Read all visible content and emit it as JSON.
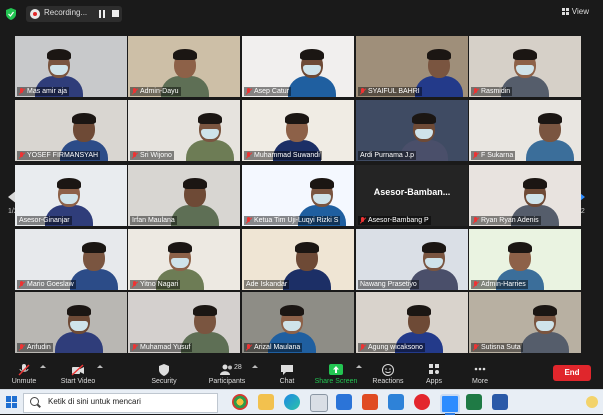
{
  "recording": {
    "label": "Recording..."
  },
  "view": {
    "label": "View"
  },
  "pagination": {
    "left": "1/2",
    "right": "1/2"
  },
  "participants": [
    {
      "name": "Mas amir aja",
      "muted": true,
      "video": true
    },
    {
      "name": "Admin-Dayu",
      "muted": true,
      "video": true
    },
    {
      "name": "Asep Catur",
      "muted": true,
      "video": true
    },
    {
      "name": "SYAIFUL BAHRI",
      "muted": true,
      "video": true
    },
    {
      "name": "Rasmidin",
      "muted": true,
      "video": true
    },
    {
      "name": "YOSEF FIRMANSYAH",
      "muted": true,
      "video": true
    },
    {
      "name": "Sri Wijono",
      "muted": true,
      "video": true
    },
    {
      "name": "Muhammad Suwandi",
      "muted": true,
      "video": true
    },
    {
      "name": "Ardi Purnama J.p",
      "muted": false,
      "video": true
    },
    {
      "name": "F Sukarna",
      "muted": true,
      "video": true
    },
    {
      "name": "Asesor-Ginanjar",
      "muted": false,
      "video": true
    },
    {
      "name": "Irfan Maulana",
      "muted": false,
      "video": true
    },
    {
      "name": "Ketua Tim Uji-Luqyi Rizki S",
      "muted": true,
      "video": true
    },
    {
      "name": "Asesor-Bambang P",
      "muted": true,
      "video": false,
      "display": "Asesor-Bamban..."
    },
    {
      "name": "Ryan Ryan Adenis",
      "muted": true,
      "video": true
    },
    {
      "name": "Mario Goeslaw",
      "muted": true,
      "video": true
    },
    {
      "name": "Yitno Nagari",
      "muted": true,
      "video": true
    },
    {
      "name": "Ade Iskandar",
      "muted": false,
      "video": true
    },
    {
      "name": "Nawang Prasetiyo",
      "muted": false,
      "video": true
    },
    {
      "name": "Admin-Harries",
      "muted": true,
      "video": true
    },
    {
      "name": "Arifudin",
      "muted": true,
      "video": true
    },
    {
      "name": "Muhamad Yusuf",
      "muted": true,
      "video": true
    },
    {
      "name": "Arizal Maulana",
      "muted": true,
      "video": true
    },
    {
      "name": "Agung wicaksono",
      "muted": true,
      "video": true
    },
    {
      "name": "Sutisna Suta",
      "muted": true,
      "video": true
    }
  ],
  "toolbar": {
    "unmute": "Unmute",
    "start_video": "Start Video",
    "security": "Security",
    "participants": "Participants",
    "participants_count": "28",
    "chat": "Chat",
    "share_screen": "Share Screen",
    "reactions": "Reactions",
    "apps": "Apps",
    "more": "More",
    "end": "End"
  },
  "taskbar": {
    "search_placeholder": "Ketik di sini untuk mencari"
  },
  "colors": {
    "accent": "#2d8cff",
    "end": "#e0262c",
    "mic_muted": "#e33333",
    "share": "#23c552"
  }
}
